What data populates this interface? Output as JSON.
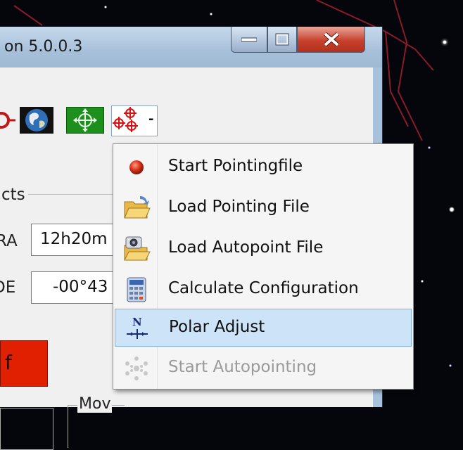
{
  "window": {
    "title": "on 5.0.0.3"
  },
  "main": {
    "group_label": "cts",
    "ra": {
      "label": "RA",
      "value": "12h20m"
    },
    "de": {
      "label": "DE",
      "value": "-00°43"
    },
    "red_button_label": "f",
    "move_label": "Mov"
  },
  "toolbar": {
    "dropdown_arrow": "-"
  },
  "menu": {
    "items": [
      {
        "label": "Start Pointingfile",
        "icon": "red-ball-icon"
      },
      {
        "label": "Load Pointing File",
        "icon": "open-folder-icon"
      },
      {
        "label": "Load Autopoint File",
        "icon": "camera-folder-icon"
      },
      {
        "label": "Calculate Configuration",
        "icon": "calculator-icon"
      },
      {
        "label": "Polar Adjust",
        "icon": "north-crosshair-icon"
      },
      {
        "label": "Start Autopointing",
        "icon": "snowflake-icon"
      }
    ],
    "selected_index": 4,
    "disabled_index": 5
  },
  "colors": {
    "selection": "#cde3f7",
    "close_button": "#c8412d",
    "red_button": "#e02000",
    "green_button": "#1c8f1c"
  }
}
